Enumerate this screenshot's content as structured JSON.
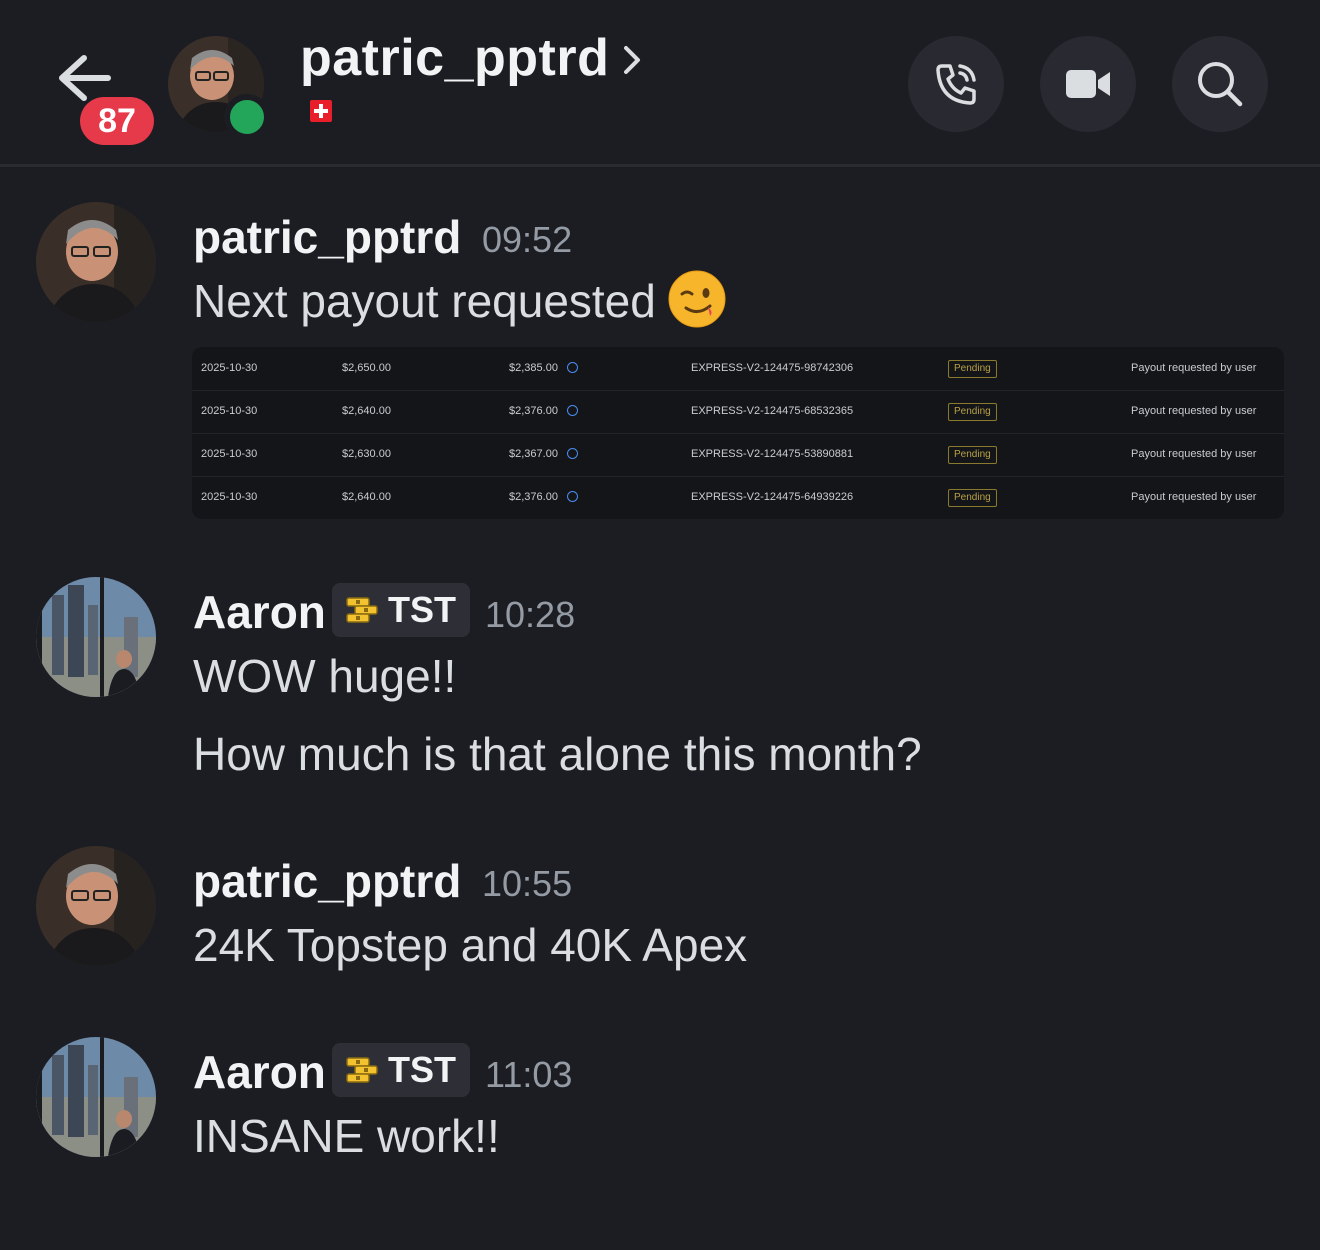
{
  "header": {
    "title": "patric_pptrd",
    "unread_count": "87",
    "status": "online",
    "flag": "swiss-flag-icon",
    "buttons": [
      "call-icon",
      "video-icon",
      "search-icon"
    ]
  },
  "messages": [
    {
      "username": "patric_pptrd",
      "time": "09:52",
      "text": "Next payout requested",
      "emoji": "winking-face-emoji",
      "attachment": {
        "rows": [
          {
            "date": "2025-10-30",
            "amount": "$2,650.00",
            "net": "$2,385.00",
            "id": "EXPRESS-V2-124475-98742306",
            "status": "Pending",
            "note": "Payout requested by user"
          },
          {
            "date": "2025-10-30",
            "amount": "$2,640.00",
            "net": "$2,376.00",
            "id": "EXPRESS-V2-124475-68532365",
            "status": "Pending",
            "note": "Payout requested by user"
          },
          {
            "date": "2025-10-30",
            "amount": "$2,630.00",
            "net": "$2,367.00",
            "id": "EXPRESS-V2-124475-53890881",
            "status": "Pending",
            "note": "Payout requested by user"
          },
          {
            "date": "2025-10-30",
            "amount": "$2,640.00",
            "net": "$2,376.00",
            "id": "EXPRESS-V2-124475-64939226",
            "status": "Pending",
            "note": "Payout requested by user"
          }
        ]
      }
    },
    {
      "username": "Aaron",
      "tag": "TST",
      "time": "10:28",
      "lines": [
        "WOW huge!!",
        "How much is that alone this month?"
      ]
    },
    {
      "username": "patric_pptrd",
      "time": "10:55",
      "text": "24K Topstep and 40K Apex"
    },
    {
      "username": "Aaron",
      "tag": "TST",
      "time": "11:03",
      "text": "INSANE work!!"
    }
  ],
  "colors": {
    "background": "#1c1d22",
    "badge": "#e6394a",
    "online": "#23a55a",
    "tag_bg": "#2e2f36",
    "muted": "#949ba4"
  }
}
